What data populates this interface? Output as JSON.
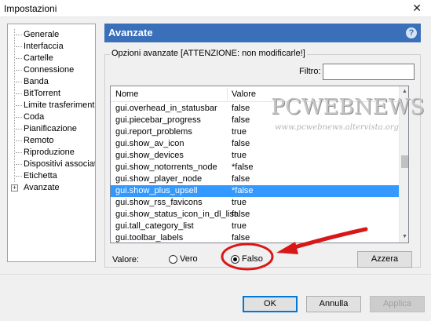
{
  "window": {
    "title": "Impostazioni",
    "close_glyph": "✕"
  },
  "sidebar": {
    "items": [
      {
        "label": "Generale"
      },
      {
        "label": "Interfaccia"
      },
      {
        "label": "Cartelle"
      },
      {
        "label": "Connessione"
      },
      {
        "label": "Banda"
      },
      {
        "label": "BitTorrent"
      },
      {
        "label": "Limite trasferimento"
      },
      {
        "label": "Coda"
      },
      {
        "label": "Pianificazione"
      },
      {
        "label": "Remoto"
      },
      {
        "label": "Riproduzione"
      },
      {
        "label": "Dispositivi associati"
      },
      {
        "label": "Etichetta"
      },
      {
        "label": "Avanzate",
        "expander": "+"
      }
    ]
  },
  "section": {
    "title": "Avanzate",
    "help_glyph": "?"
  },
  "group": {
    "legend": "Opzioni avanzate [ATTENZIONE: non modificarle!]"
  },
  "filter": {
    "label": "Filtro:",
    "value": ""
  },
  "table": {
    "columns": [
      "Nome",
      "Valore"
    ],
    "rows": [
      {
        "name": "gui.overhead_in_statusbar",
        "value": "false"
      },
      {
        "name": "gui.piecebar_progress",
        "value": "false"
      },
      {
        "name": "gui.report_problems",
        "value": "true"
      },
      {
        "name": "gui.show_av_icon",
        "value": "false"
      },
      {
        "name": "gui.show_devices",
        "value": "true"
      },
      {
        "name": "gui.show_notorrents_node",
        "value": "*false"
      },
      {
        "name": "gui.show_player_node",
        "value": "false"
      },
      {
        "name": "gui.show_plus_upsell",
        "value": "*false",
        "selected": true
      },
      {
        "name": "gui.show_rss_favicons",
        "value": "true"
      },
      {
        "name": "gui.show_status_icon_in_dl_list",
        "value": "false"
      },
      {
        "name": "gui.tall_category_list",
        "value": "true"
      },
      {
        "name": "gui.toolbar_labels",
        "value": "false"
      }
    ],
    "scroll": {
      "up_glyph": "▲",
      "down_glyph": "▼"
    }
  },
  "value_editor": {
    "label": "Valore:",
    "options": [
      {
        "label": "Vero",
        "checked": false
      },
      {
        "label": "Falso",
        "checked": true
      }
    ],
    "reset_label": "Azzera"
  },
  "footer": {
    "ok_label": "OK",
    "cancel_label": "Annulla",
    "apply_label": "Applica"
  },
  "watermark": {
    "title": "PCWEBNEWS",
    "url": "www.pcwebnews.altervista.org"
  },
  "annotation_colors": {
    "highlight": "#d81818"
  }
}
